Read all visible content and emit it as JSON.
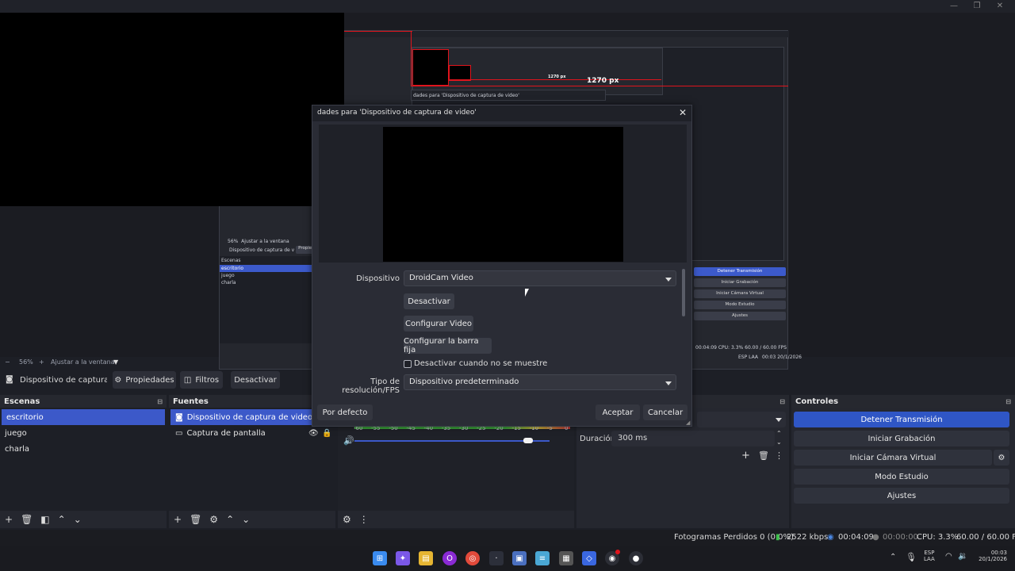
{
  "preview": {
    "nested_measure_label": "1270 px",
    "nested_measure_label_small": "1270 px",
    "nested_dialog_title": "dades para 'Dispositivo de captura de video'",
    "nested_zoom": "56%",
    "nested_fit": "Ajustar a la ventana",
    "nested_source": "Dispositivo de captura de v",
    "nested_props": "Propiedades",
    "nested_scenes_header": "Escenas",
    "nested_scenes": [
      "escritorio",
      "juego",
      "charla"
    ],
    "nested_controls": [
      "Detener Transmisión",
      "Iniciar Grabación",
      "Iniciar Cámara Virtual",
      "Modo Estudio",
      "Ajustes"
    ],
    "nested_status": "00:04:09  CPU: 3.3%  60.00 / 60.00 FPS",
    "nested_lang": "ESP LAA",
    "nested_clock": "00:03 20/1/2026"
  },
  "zoombar": {
    "minus": "−",
    "zoom": "56%",
    "plus": "+",
    "fit": "Ajustar a la ventana"
  },
  "toolbar": {
    "source_name": "Dispositivo de captura de v",
    "properties": "Propiedades",
    "filters": "Filtros",
    "deactivate": "Desactivar"
  },
  "dialog": {
    "title": "dades para 'Dispositivo de captura de video'",
    "device_label": "Dispositivo",
    "device_value": "DroidCam Video",
    "btn_deactivate": "Desactivar",
    "btn_config_video": "Configurar Video",
    "btn_config_bar": "Configurar la barra fija",
    "checkbox_label": "Desactivar cuando no se muestre",
    "res_label": "Tipo de resolución/FPS",
    "res_value": "Dispositivo predeterminado",
    "btn_default": "Por defecto",
    "btn_accept": "Aceptar",
    "btn_cancel": "Cancelar"
  },
  "scenes": {
    "header": "Escenas",
    "items": [
      "escritorio",
      "juego",
      "charla"
    ]
  },
  "sources": {
    "header": "Fuentes",
    "items": [
      "Dispositivo de captura de video",
      "Captura de pantalla"
    ]
  },
  "mixer": {
    "ticks": [
      "-60",
      "-55",
      "-50",
      "-45",
      "-40",
      "-35",
      "-30",
      "-25",
      "-20",
      "-15",
      "-10",
      "-5",
      "0"
    ],
    "volume_fraction": 0.89
  },
  "transitions": {
    "duration_label": "Duración",
    "duration_value": "300 ms"
  },
  "controls": {
    "header": "Controles",
    "stop_stream": "Detener Transmisión",
    "start_record": "Iniciar Grabación",
    "virtual_cam": "Iniciar Cámara Virtual",
    "studio_mode": "Modo Estudio",
    "settings": "Ajustes"
  },
  "status": {
    "dropped": "Fotogramas Perdidos 0 (0.0%)",
    "bitrate": "2522 kbps",
    "stream_time": "00:04:09",
    "record_time": "00:00:00",
    "cpu": "CPU: 3.3%",
    "fps": "60.00 / 60.00 FPS"
  },
  "tray": {
    "lang_top": "ESP",
    "lang_bottom": "LAA",
    "time": "00:03",
    "date": "20/1/2026"
  },
  "colors": {
    "accent": "#3c59c9",
    "stream_button": "#2f56c5",
    "recording_line": "#e0141c"
  }
}
